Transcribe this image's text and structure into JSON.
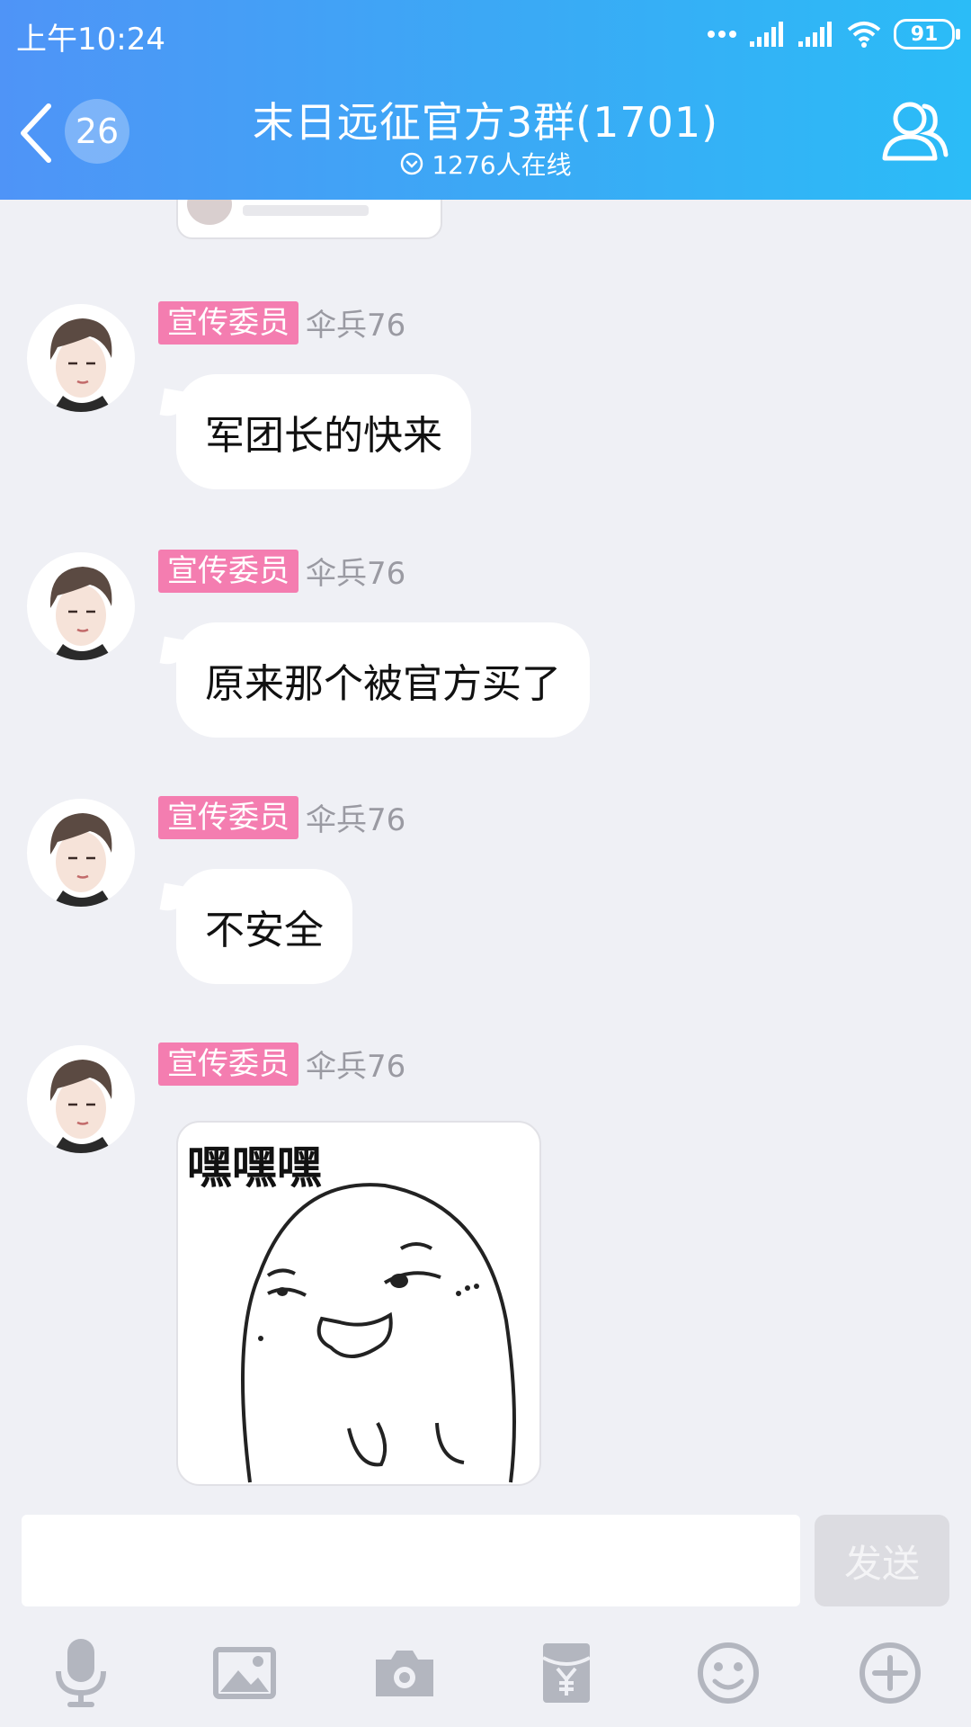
{
  "status_bar": {
    "time": "上午10:24",
    "battery": "91"
  },
  "header": {
    "unread_count": "26",
    "title": "末日远征官方3群(1701)",
    "online": "1276人在线"
  },
  "messages": [
    {
      "role_tag": "宣传委员",
      "sender": "伞兵76",
      "text": "军团长的快来"
    },
    {
      "role_tag": "宣传委员",
      "sender": "伞兵76",
      "text": "原来那个被官方买了"
    },
    {
      "role_tag": "宣传委员",
      "sender": "伞兵76",
      "text": "不安全"
    },
    {
      "role_tag": "宣传委员",
      "sender": "伞兵76",
      "sticker_text": "嘿嘿嘿"
    }
  ],
  "input": {
    "value": "",
    "send_label": "发送"
  },
  "toolbar": {
    "icons": [
      "microphone-icon",
      "image-icon",
      "camera-icon",
      "red-packet-icon",
      "emoji-icon",
      "plus-icon"
    ]
  },
  "colors": {
    "header_start": "#4f94f7",
    "header_end": "#2bbcf7",
    "role_tag": "#f47db0",
    "chat_background": "#eff0f5"
  }
}
